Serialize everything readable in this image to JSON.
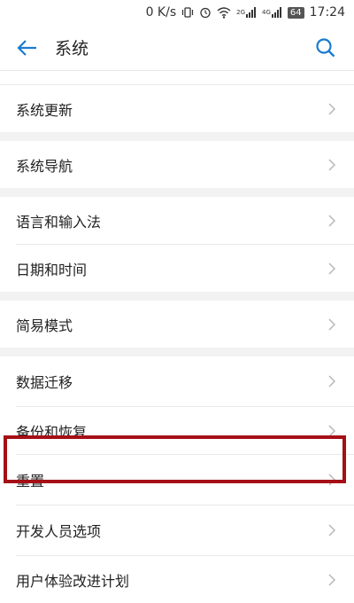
{
  "status_bar": {
    "network_speed": "0 K/s",
    "signal_2g": "2G",
    "signal_4g": "4G",
    "battery": "64",
    "time": "17:24"
  },
  "header": {
    "title": "系统"
  },
  "colors": {
    "accent": "#1a7bd1",
    "highlight_border": "#a50f16",
    "section_gap": "#f2f2f2",
    "chevron": "#b8b8b8"
  },
  "sections": [
    {
      "items": [
        {
          "label": "系统更新"
        }
      ]
    },
    {
      "items": [
        {
          "label": "系统导航"
        }
      ]
    },
    {
      "items": [
        {
          "label": "语言和输入法"
        },
        {
          "label": "日期和时间"
        }
      ]
    },
    {
      "items": [
        {
          "label": "简易模式"
        }
      ]
    },
    {
      "items": [
        {
          "label": "数据迁移"
        },
        {
          "label": "备份和恢复"
        },
        {
          "label": "重置"
        },
        {
          "label": "开发人员选项"
        },
        {
          "label": "用户体验改进计划"
        }
      ]
    }
  ]
}
